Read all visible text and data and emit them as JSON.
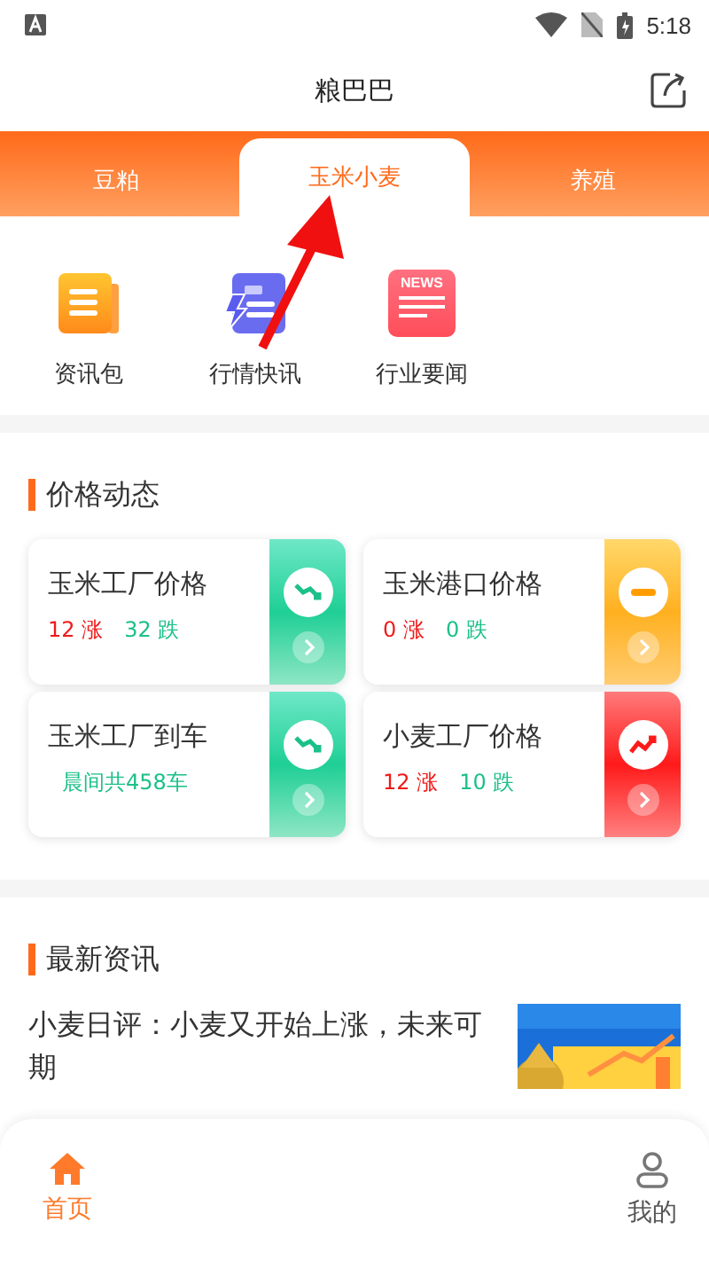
{
  "status_bar": {
    "time": "5:18"
  },
  "header": {
    "title": "粮巴巴"
  },
  "tabs": [
    {
      "label": "豆粕",
      "selected": false
    },
    {
      "label": "玉米小麦",
      "selected": true
    },
    {
      "label": "养殖",
      "selected": false
    }
  ],
  "shortcuts": [
    {
      "label": "资讯包",
      "kind": "paper"
    },
    {
      "label": "行情快讯",
      "kind": "flash"
    },
    {
      "label": "行业要闻",
      "kind": "news",
      "badge": "NEWS"
    }
  ],
  "price_section": {
    "title": "价格动态",
    "cards": [
      {
        "title": "玉米工厂价格",
        "kind": "down",
        "rise": "12 涨",
        "fall": "32 跌"
      },
      {
        "title": "玉米港口价格",
        "kind": "flat",
        "rise": "0 涨",
        "fall": "0 跌"
      },
      {
        "title": "玉米工厂到车",
        "kind": "down",
        "note": "晨间共458车"
      },
      {
        "title": "小麦工厂价格",
        "kind": "up",
        "rise": "12 涨",
        "fall": "10 跌"
      }
    ]
  },
  "news_section": {
    "title": "最新资讯",
    "articles": [
      {
        "title": "小麦日评：小麦又开始上涨，未来可期",
        "kind": "picture"
      }
    ]
  },
  "bottom_nav": [
    {
      "label": "首页",
      "kind": "home",
      "selected": true
    },
    {
      "label": "我的",
      "kind": "user",
      "selected": false
    }
  ],
  "annotation": {
    "kind": "arrow"
  }
}
